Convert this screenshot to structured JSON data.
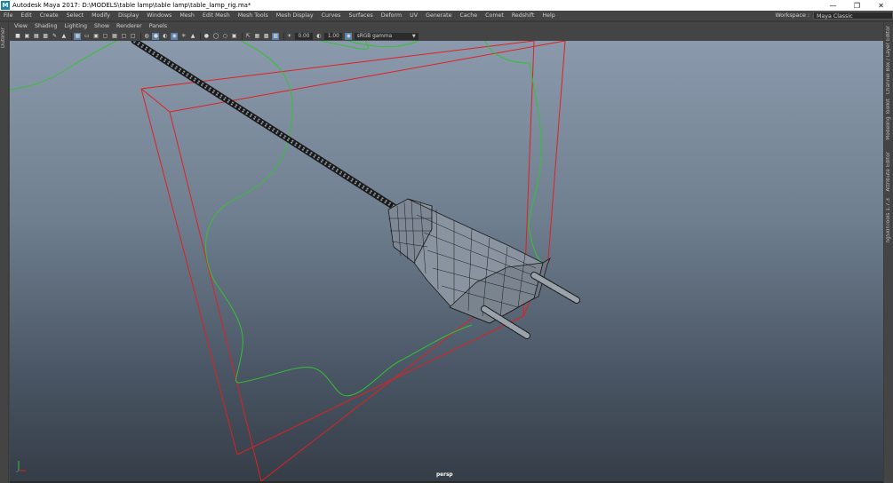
{
  "window": {
    "title": "Autodesk Maya 2017: D:\\MODELS\\table lamp\\table lamp\\table_lamp_rig.ma*",
    "logo": "M",
    "minimize_icon": "minimize-icon",
    "restore_icon": "restore-icon",
    "close_icon": "close-icon"
  },
  "menubar": {
    "items": [
      "File",
      "Edit",
      "Create",
      "Select",
      "Modify",
      "Display",
      "Windows",
      "Mesh",
      "Edit Mesh",
      "Mesh Tools",
      "Mesh Display",
      "Curves",
      "Surfaces",
      "Deform",
      "UV",
      "Generate",
      "Cache",
      "Comet",
      "Redshift",
      "Help"
    ],
    "workspace_label": "Workspace :",
    "workspace_value": "Maya Classic"
  },
  "left_strip": {
    "label": "Outliner"
  },
  "right_strip": {
    "tabs": [
      "Channel Box / Layer Editor",
      "Modeling Toolkit",
      "Attribute Editor",
      "ngSkinTools 1.7.3"
    ]
  },
  "panel_menu": {
    "items": [
      "View",
      "Shading",
      "Lighting",
      "Show",
      "Renderer",
      "Panels"
    ]
  },
  "panel_toolbar": {
    "exposure_value": "0.00",
    "gamma_value": "1.00",
    "color_space": "sRGB gamma"
  },
  "viewport": {
    "camera": "persp",
    "colors": {
      "bg_top": "#8a9aac",
      "bg_bottom": "#353d47",
      "red_box": "#e02020",
      "green_curve": "#33c233",
      "wire": "#1a1a1a"
    }
  }
}
